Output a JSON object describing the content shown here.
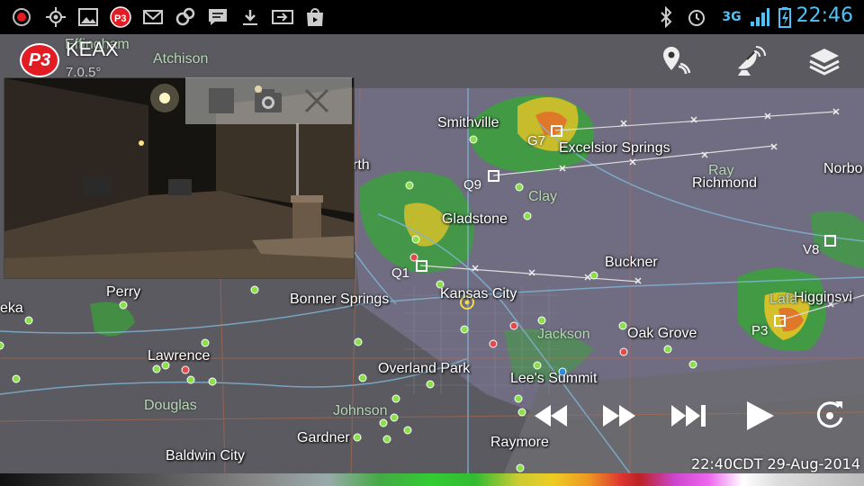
{
  "status_bar": {
    "time": "22:46",
    "network": "3G",
    "left_icons": [
      "record-icon",
      "gps-icon",
      "gallery-icon",
      "p3-icon",
      "gmail-icon",
      "sync-icon",
      "chat-icon",
      "download-icon",
      "forward-icon",
      "store-icon"
    ]
  },
  "app": {
    "logo_text": "P3",
    "station": "KEAX",
    "tilt": "7.0.5°"
  },
  "cities": [
    {
      "name": "Effingham",
      "dim": true
    },
    {
      "name": "Atchison",
      "dim": true
    },
    {
      "name": "Smithville",
      "dim": false
    },
    {
      "name": "Excelsior Springs",
      "dim": false
    },
    {
      "name": "Ray",
      "dim": true
    },
    {
      "name": "Richmond",
      "dim": false
    },
    {
      "name": "Norbo",
      "dim": false
    },
    {
      "name": "Clay",
      "dim": true
    },
    {
      "name": "Gladstone",
      "dim": false
    },
    {
      "name": "Buckner",
      "dim": false
    },
    {
      "name": "Higginsvi",
      "dim": false
    },
    {
      "name": "Perry",
      "dim": false
    },
    {
      "name": "Bonner Springs",
      "dim": false
    },
    {
      "name": "Kansas City",
      "dim": false
    },
    {
      "name": "Jackson",
      "dim": true
    },
    {
      "name": "Oak Grove",
      "dim": false
    },
    {
      "name": "Lawrence",
      "dim": false
    },
    {
      "name": "Overland Park",
      "dim": false
    },
    {
      "name": "Lee's Summit",
      "dim": false
    },
    {
      "name": "Douglas",
      "dim": true
    },
    {
      "name": "Johnson",
      "dim": true
    },
    {
      "name": "Gardner",
      "dim": false
    },
    {
      "name": "Raymore",
      "dim": false
    },
    {
      "name": "Baldwin City",
      "dim": false
    },
    {
      "name": "eka",
      "dim": false
    },
    {
      "name": "rth",
      "dim": false
    },
    {
      "name": "Lafa",
      "dim": true
    }
  ],
  "storm_markers": [
    "G7",
    "Q9",
    "Q1",
    "V8",
    "P3"
  ],
  "timestamp": "22:40CDT 29-Aug-2014"
}
